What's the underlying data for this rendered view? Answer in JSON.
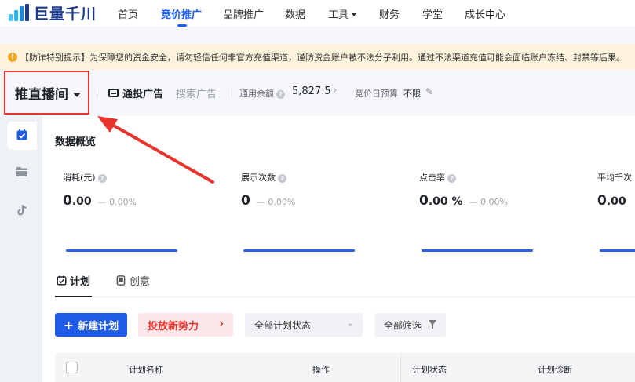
{
  "brand": {
    "logo_text": "巨量千川"
  },
  "nav": {
    "items": [
      {
        "label": "首页"
      },
      {
        "label": "竞价推广"
      },
      {
        "label": "品牌推广"
      },
      {
        "label": "数据"
      },
      {
        "label": "工具"
      },
      {
        "label": "财务"
      },
      {
        "label": "学堂"
      },
      {
        "label": "成长中心"
      }
    ],
    "active_index": 1
  },
  "notice": {
    "text": "【防诈特别提示】为保障您的资金安全，请勿轻信任何非官方充值渠道，谨防资金账户被不法分子利用。通过不法渠道充值可能会面临账户冻结、封禁等后果。"
  },
  "account": {
    "title": "推直播间",
    "ad_type": "通投广告",
    "search_ad": "搜索广告",
    "balance_label": "通用余额",
    "balance_value": "5,827.5",
    "budget_label": "竞价日预算",
    "budget_value": "不限"
  },
  "overview": {
    "title": "数据概览",
    "metrics": [
      {
        "label": "消耗(元)",
        "value_int": "0",
        "value_dec": ".00",
        "change": "0.00%"
      },
      {
        "label": "展示次数",
        "value_int": "0",
        "value_dec": "",
        "change": "0.00%"
      },
      {
        "label": "点击率",
        "value_int": "0",
        "value_dec": ".00 %",
        "change": "0.00%"
      },
      {
        "label": "平均千次",
        "value_int": "0",
        "value_dec": ".00",
        "change": ""
      }
    ]
  },
  "tabs": [
    {
      "label": "计划"
    },
    {
      "label": "创意"
    }
  ],
  "actions": {
    "new_plan": "新建计划",
    "promo": "投放新势力",
    "status_select": "全部计划状态",
    "filter": "全部筛选"
  },
  "table": {
    "headers": [
      "计划名称",
      "操作",
      "计划状态",
      "计划诊断"
    ]
  },
  "colors": {
    "primary": "#1f5ce5",
    "nav_active": "#1a5cff",
    "highlight_box": "#e8342c",
    "notice_bg": "#fdf3dd",
    "metric_line": "#2e62e6"
  }
}
